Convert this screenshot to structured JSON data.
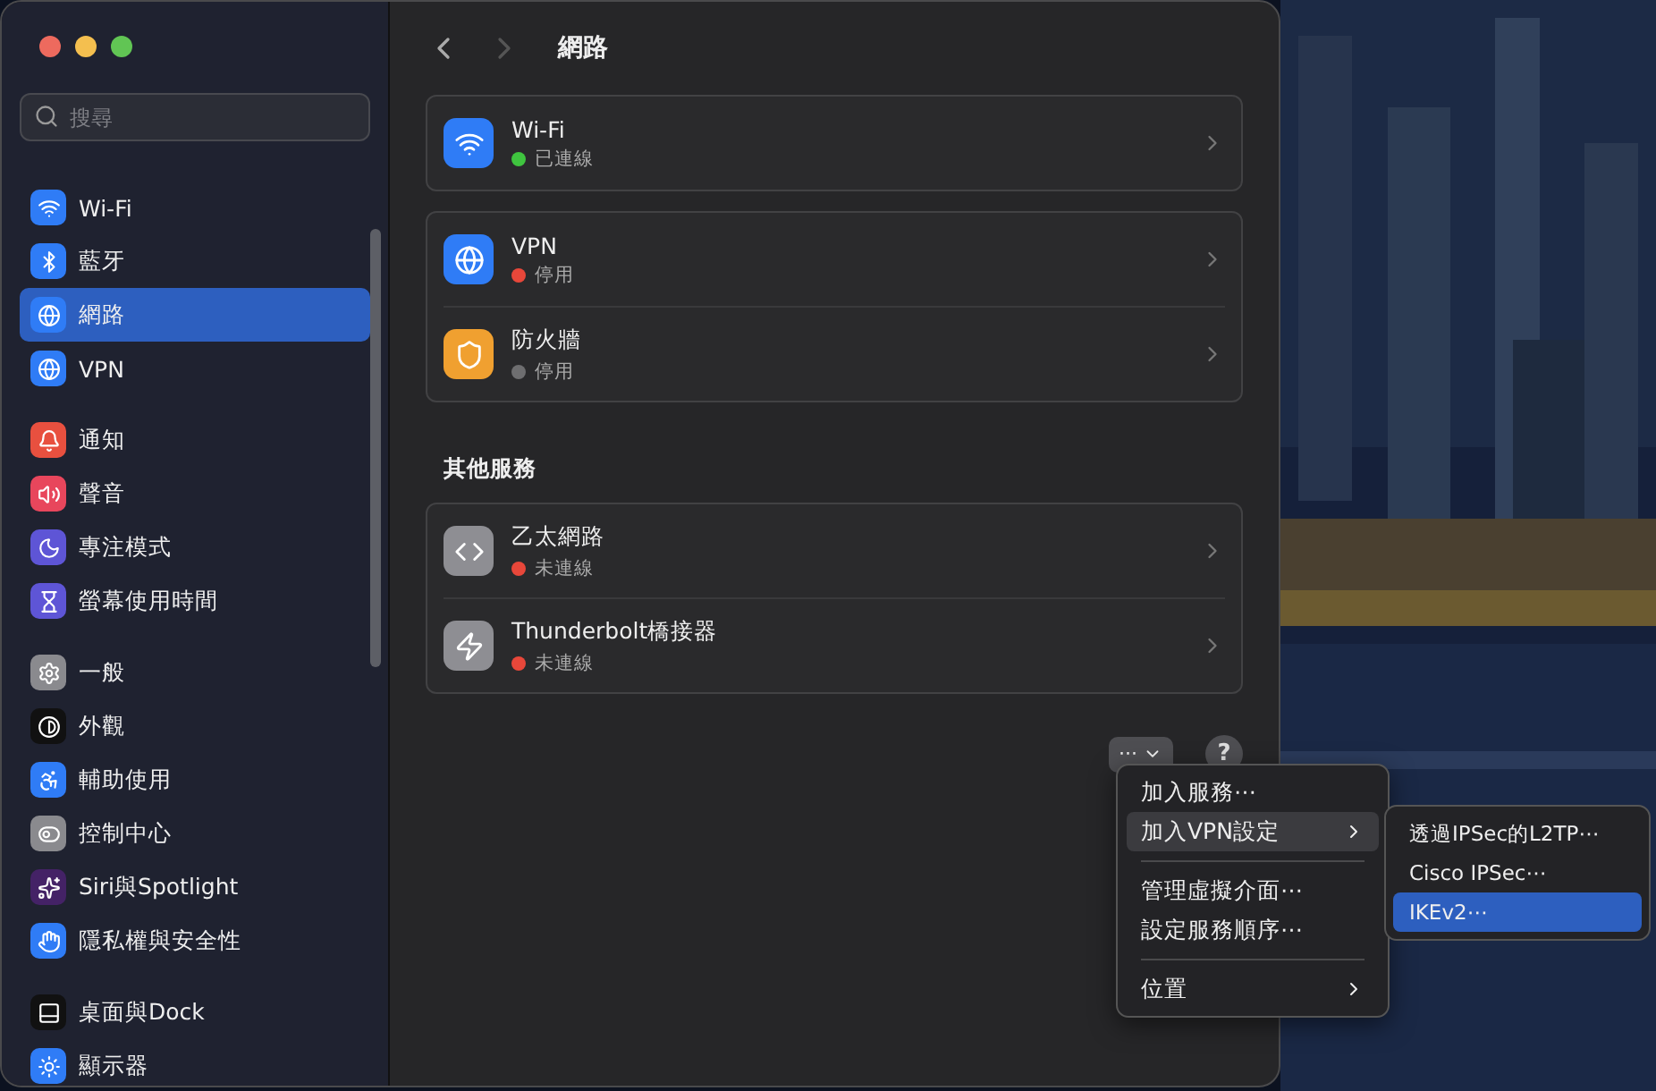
{
  "sidebar": {
    "search": {
      "placeholder": "搜尋"
    },
    "groups": [
      [
        {
          "label": "Wi-Fi",
          "selected": false
        },
        {
          "label": "藍牙",
          "selected": false
        },
        {
          "label": "網路",
          "selected": true
        },
        {
          "label": "VPN",
          "selected": false
        }
      ],
      [
        {
          "label": "通知",
          "selected": false
        },
        {
          "label": "聲音",
          "selected": false
        },
        {
          "label": "專注模式",
          "selected": false
        },
        {
          "label": "螢幕使用時間",
          "selected": false
        }
      ],
      [
        {
          "label": "一般",
          "selected": false
        },
        {
          "label": "外觀",
          "selected": false
        },
        {
          "label": "輔助使用",
          "selected": false
        },
        {
          "label": "控制中心",
          "selected": false
        },
        {
          "label": "Siri與Spotlight",
          "selected": false
        },
        {
          "label": "隱私權與安全性",
          "selected": false
        }
      ],
      [
        {
          "label": "桌面與Dock",
          "selected": false
        },
        {
          "label": "顯示器",
          "selected": false
        }
      ]
    ]
  },
  "content": {
    "title": "網路",
    "forward_disabled": true,
    "groups": [
      {
        "services": [
          {
            "name": "Wi-Fi",
            "status": "已連線",
            "color": "#3fc43f"
          }
        ]
      },
      {
        "services": [
          {
            "name": "VPN",
            "status": "停用",
            "color": "#e8473a"
          },
          {
            "name": "防火牆",
            "status": "停用",
            "color": "#6e6e70"
          }
        ]
      },
      {
        "heading": "其他服務",
        "services": [
          {
            "name": "乙太網路",
            "status": "未連線",
            "color": "#e8473a"
          },
          {
            "name": "Thunderbolt橋接器",
            "status": "未連線",
            "color": "#e8473a"
          }
        ]
      }
    ],
    "more_button": "···",
    "help_button": "?"
  },
  "menu": {
    "items": [
      {
        "kind": "item",
        "label": "加入服務⋯",
        "selected": false
      },
      {
        "kind": "submenu",
        "label": "加入VPN設定",
        "selected": true
      },
      {
        "kind": "separator"
      },
      {
        "kind": "item",
        "label": "管理虛擬介面⋯",
        "selected": false
      },
      {
        "kind": "item",
        "label": "設定服務順序⋯",
        "selected": false
      },
      {
        "kind": "separator"
      },
      {
        "kind": "submenu",
        "label": "位置",
        "selected": false
      }
    ],
    "submenu": [
      {
        "label": "透過IPSec的L2TP⋯",
        "selected": false
      },
      {
        "label": "Cisco IPSec⋯",
        "selected": false
      },
      {
        "label": "IKEv2⋯",
        "selected": true
      }
    ]
  }
}
